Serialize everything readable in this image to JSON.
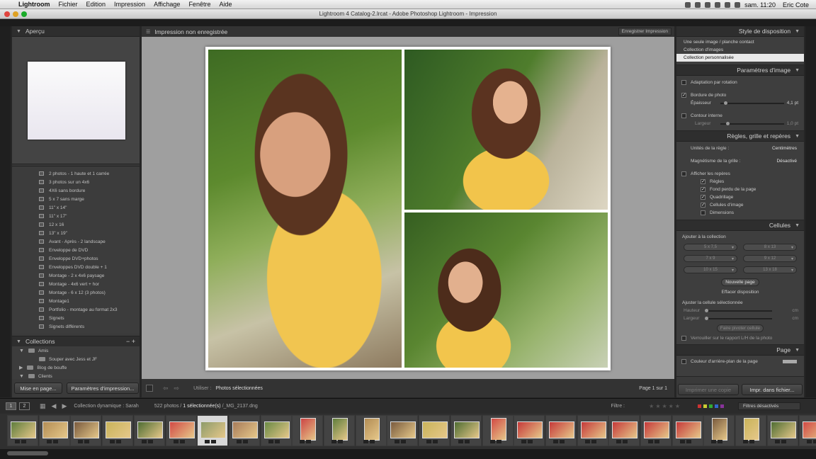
{
  "menubar": {
    "app": "Lightroom",
    "items": [
      "Fichier",
      "Edition",
      "Impression",
      "Affichage",
      "Fenêtre",
      "Aide"
    ],
    "clock": "sam. 11:20",
    "user": "Eric Cote"
  },
  "window": {
    "title": "Lightroom 4 Catalog-2.lrcat - Adobe Photoshop Lightroom - Impression"
  },
  "left": {
    "preview_header": "Aperçu",
    "templates": [
      "2 photos - 1 haute et 1 carrée",
      "3 photos sur un 4x6",
      "4X6 sans bordure",
      "5 x 7 sans marge",
      "11\" x 14\"",
      "11\" x 17\"",
      "12 x 16",
      "13\" x 19\"",
      "Avant - Après - 2 landscape",
      "Enveloppe de DVD",
      "Enveloppe DVD+photos",
      "Enveloppes DVD double + 1",
      "Montage - 2 x 4x6 paysage",
      "Montage - 4x6 vert + hor",
      "Montage - 6 x 12 (3 photos)",
      "Montage1",
      "Portfolio - montage au format 2x3",
      "Signets",
      "Signets différents"
    ],
    "collections_header": "Collections",
    "collections": [
      {
        "label": "Amis",
        "indent": 0
      },
      {
        "label": "Souper avec Jess et JF",
        "indent": 1
      },
      {
        "label": "Blog de bouffe",
        "indent": 0
      },
      {
        "label": "Clients",
        "indent": 0
      }
    ],
    "btn_page_setup": "Mise en page...",
    "btn_print_settings": "Paramètres d'impression..."
  },
  "center": {
    "title": "Impression non enregistrée",
    "save_button": "Enregistrer Impression",
    "use_label": "Utiliser :",
    "use_value": "Photos sélectionnées",
    "page_info": "Page 1 sur 1"
  },
  "right": {
    "layout_style_header": "Style de disposition",
    "layout_options": [
      "Une seule image / planche contact",
      "Collection d'images",
      "Collection personnalisée"
    ],
    "selected_layout_index": 2,
    "image_settings_header": "Paramètres d'image",
    "rotate_to_fit": "Adaptation par rotation",
    "photo_border": "Bordure de photo",
    "thickness_label": "Épaisseur",
    "thickness_value": "4,1 pt",
    "inner_stroke": "Contour interne",
    "width_label": "Largeur",
    "width_value": "1,0 pt",
    "rulers_header": "Règles, grille et repères",
    "ruler_units_label": "Unités de la règle :",
    "ruler_units_value": "Centimètres",
    "grid_snap_label": "Magnétisme de la grille :",
    "grid_snap_value": "Désactivé",
    "show_guides": "Afficher les repères",
    "guides": [
      "Règles",
      "Fond perdu de la page",
      "Quadrillage",
      "Cellules d'image",
      "Dimensions"
    ],
    "cells_header": "Cellules",
    "add_to_package": "Ajouter à la collection",
    "cell_sizes": [
      "5 x 7,5",
      "8 x 13",
      "7 x 9",
      "9 x 12",
      "10 x 15",
      "13 x 18"
    ],
    "new_page": "Nouvelle page",
    "clear_layout": "Effacer disposition",
    "adjust_cell": "Ajuster la cellule sélectionnée",
    "height_label": "Hauteur",
    "height_value": "cm",
    "cell_width_label": "Largeur",
    "cell_width_value": "cm",
    "make_square": "Faire pivoter cellule",
    "lock_ratio": "Verrouiller sur le rapport L/H de la photo",
    "page_header": "Page",
    "page_bg": "Couleur d'arrière-plan de la page",
    "btn_print_one": "Imprimer une copie",
    "btn_print_to": "Impr. dans fichier..."
  },
  "filmstrip": {
    "page1": "1",
    "page2": "2",
    "source": "Collection dynamique : Sarah",
    "count_prefix": "522 photos /",
    "selected": "1 sélectionnée(s)",
    "filename": "/_MG_2137.dng",
    "filter_label": "Filtre :",
    "filter_value": "Filtres désactivés"
  },
  "colors": {
    "accent_selected": "#e8e8e8",
    "panel": "#3a3a3a",
    "canvas": "#9f9f9f"
  }
}
